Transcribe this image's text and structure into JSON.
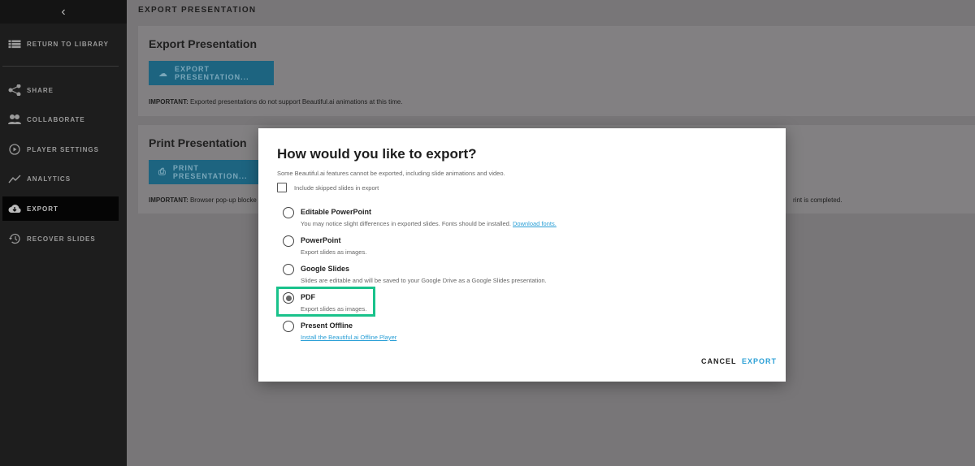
{
  "sidebar": {
    "collapse_icon": "chevron-left-icon",
    "items": [
      {
        "label": "RETURN TO LIBRARY",
        "icon": "list-icon"
      },
      {
        "label": "SHARE",
        "icon": "share-icon"
      },
      {
        "label": "COLLABORATE",
        "icon": "people-icon"
      },
      {
        "label": "PLAYER SETTINGS",
        "icon": "play-circle-icon"
      },
      {
        "label": "ANALYTICS",
        "icon": "chart-line-icon"
      },
      {
        "label": "EXPORT",
        "icon": "cloud-download-icon"
      },
      {
        "label": "RECOVER SLIDES",
        "icon": "history-icon"
      }
    ]
  },
  "main": {
    "title": "EXPORT PRESENTATION",
    "export_card": {
      "heading": "Export Presentation",
      "button": "EXPORT PRESENTATION...",
      "note_bold": "IMPORTANT:",
      "note": " Exported presentations do not support Beautiful.ai animations at this time."
    },
    "print_card": {
      "heading": "Print Presentation",
      "button": "PRINT PRESENTATION...",
      "note_bold": "IMPORTANT:",
      "note": " Browser pop-up blocke",
      "note_tail": "rint is completed."
    }
  },
  "modal": {
    "title": "How would you like to export?",
    "subtitle": "Some Beautiful.ai features cannot be exported, including slide animations and video.",
    "checkbox_label": "Include skipped slides in export",
    "checkbox_checked": false,
    "options": [
      {
        "label": "Editable PowerPoint",
        "desc": "You may notice slight differences in exported slides. Fonts should be installed. ",
        "link": "Download fonts."
      },
      {
        "label": "PowerPoint",
        "desc": "Export slides as images."
      },
      {
        "label": "Google Slides",
        "desc": "Slides are editable and will be saved to your Google Drive as a Google Slides presentation."
      },
      {
        "label": "PDF",
        "desc": "Export slides as images."
      },
      {
        "label": "Present Offline",
        "link": "Install the Beautiful.ai Offline Player"
      }
    ],
    "selected": "PDF",
    "cancel": "CANCEL",
    "export": "EXPORT",
    "accent": "#2a9fd6",
    "highlight": "#19c28b"
  }
}
